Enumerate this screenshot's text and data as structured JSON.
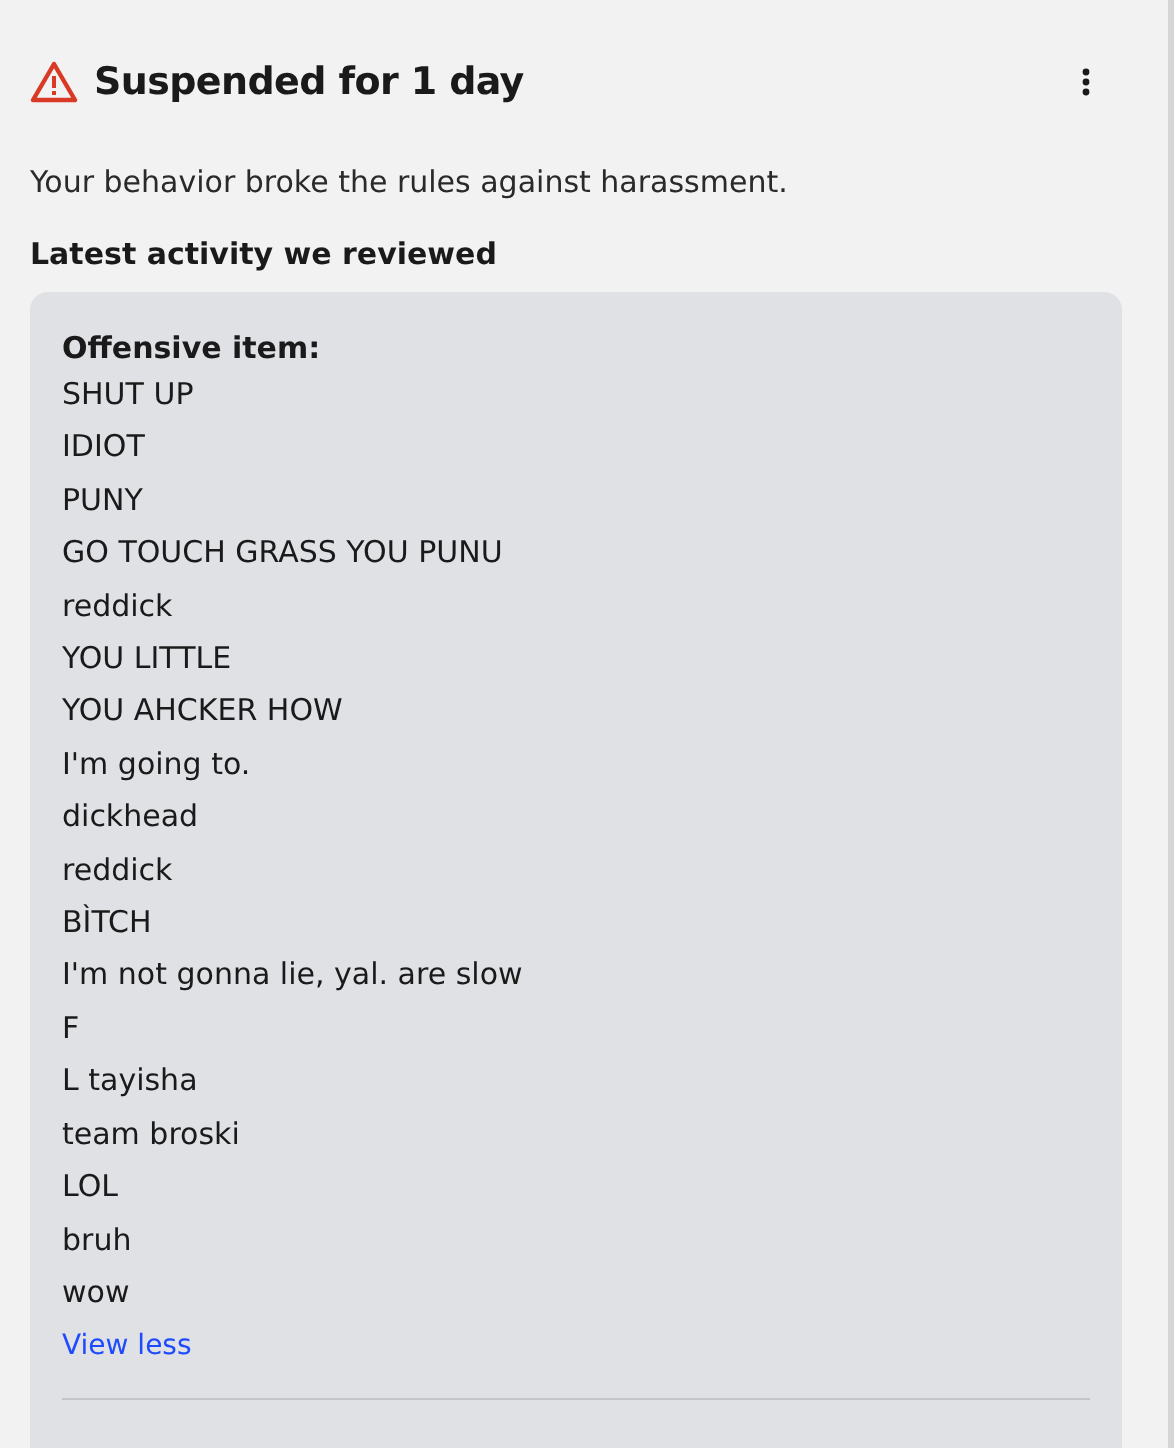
{
  "header": {
    "title": "Suspended for 1 day"
  },
  "message": "Your behavior broke the rules against harassment.",
  "section_title": "Latest activity we reviewed",
  "card": {
    "label": "Offensive item:",
    "lines": [
      "SHUT UP",
      "IDIOT",
      "PUNY",
      "GO TOUCH GRASS YOU PUNU",
      "reddick",
      "YOU LITTLE",
      "YOU AHCKER HOW",
      "I'm going to.",
      "dickhead",
      "reddick",
      "BÌTCH",
      "I'm not gonna lie, yal. are slow",
      "F",
      "L tayisha",
      "team broski",
      "LOL",
      "bruh",
      "wow"
    ],
    "toggle_link": "View less"
  }
}
